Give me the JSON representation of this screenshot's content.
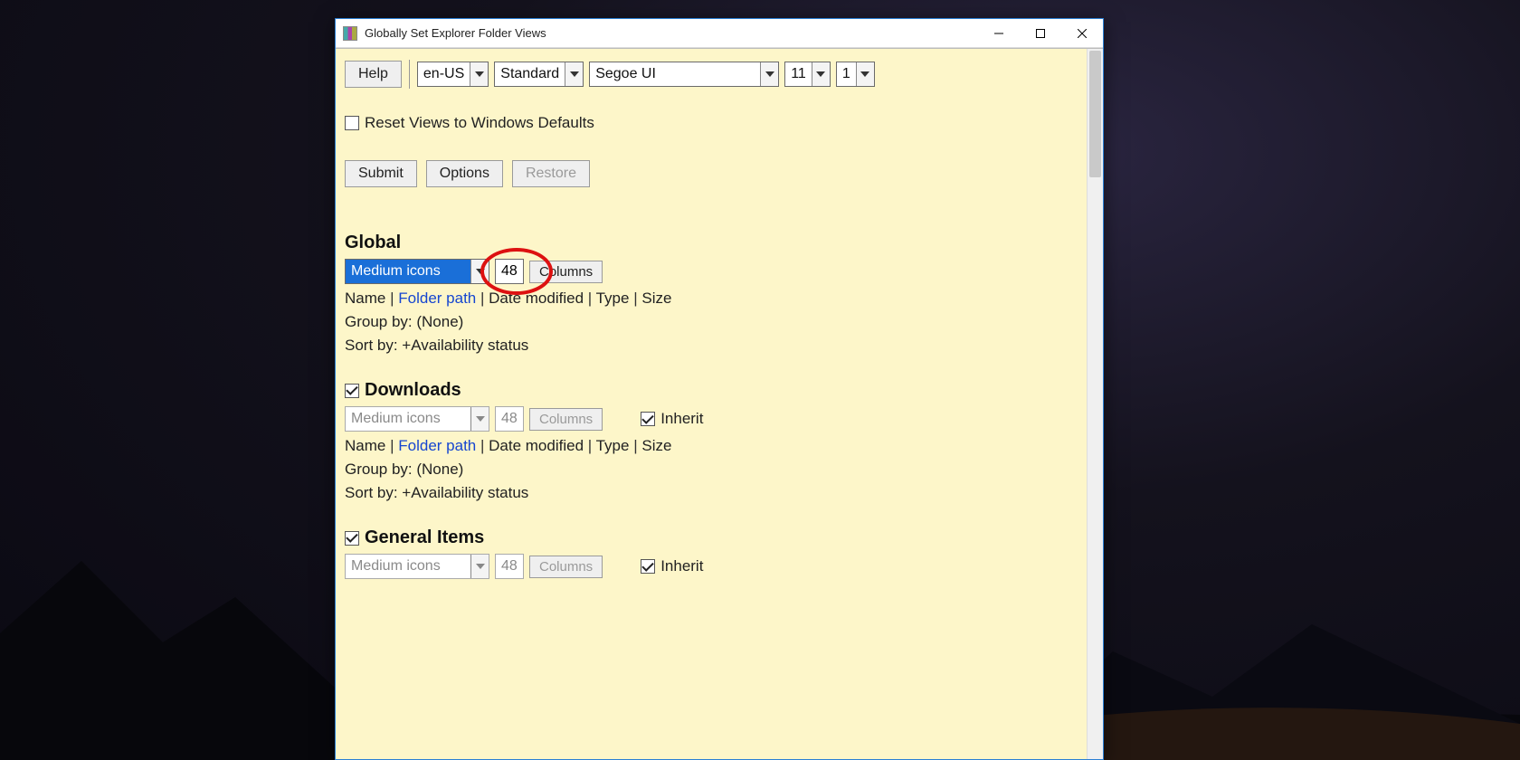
{
  "window": {
    "title": "Globally Set Explorer Folder Views"
  },
  "toolbar": {
    "help_label": "Help",
    "locale": "en-US",
    "style": "Standard",
    "font": "Segoe UI",
    "font_size": "11",
    "scale": "1"
  },
  "reset_checkbox_label": "Reset Views to Windows Defaults",
  "buttons": {
    "submit": "Submit",
    "options": "Options",
    "restore": "Restore"
  },
  "sections": {
    "global": {
      "title": "Global",
      "view": "Medium icons",
      "size": "48",
      "columns_btn": "Columns",
      "col_name": "Name",
      "col_folder": "Folder path",
      "col_date": "Date modified",
      "col_type": "Type",
      "col_size": "Size",
      "group_by": "Group by: (None)",
      "sort_by": "Sort by: +Availability status"
    },
    "downloads": {
      "title": "Downloads",
      "view": "Medium icons",
      "size": "48",
      "columns_btn": "Columns",
      "inherit": "Inherit",
      "col_name": "Name",
      "col_folder": "Folder path",
      "col_date": "Date modified",
      "col_type": "Type",
      "col_size": "Size",
      "group_by": "Group by: (None)",
      "sort_by": "Sort by: +Availability status"
    },
    "general": {
      "title": "General Items",
      "view": "Medium icons",
      "size": "48",
      "columns_btn": "Columns",
      "inherit": "Inherit"
    }
  }
}
